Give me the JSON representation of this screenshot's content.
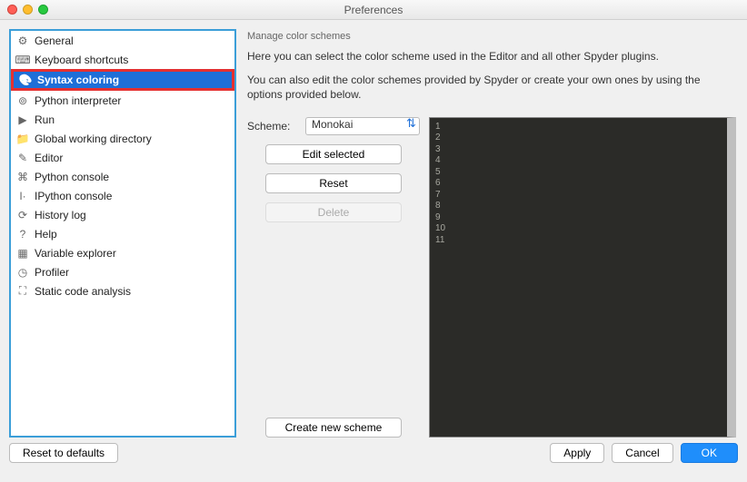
{
  "window": {
    "title": "Preferences"
  },
  "sidebar": {
    "items": [
      {
        "label": "General",
        "icon": "gear-icon",
        "selected": false
      },
      {
        "label": "Keyboard shortcuts",
        "icon": "keyboard-icon",
        "selected": false
      },
      {
        "label": "Syntax coloring",
        "icon": "palette-icon",
        "selected": true
      },
      {
        "label": "Python interpreter",
        "icon": "python-icon",
        "selected": false
      },
      {
        "label": "Run",
        "icon": "play-icon",
        "selected": false
      },
      {
        "label": "Global working directory",
        "icon": "folder-icon",
        "selected": false
      },
      {
        "label": "Editor",
        "icon": "pencil-icon",
        "selected": false
      },
      {
        "label": "Python console",
        "icon": "terminal-icon",
        "selected": false
      },
      {
        "label": "IPython console",
        "icon": "ipy-icon",
        "selected": false
      },
      {
        "label": "History log",
        "icon": "clock-icon",
        "selected": false
      },
      {
        "label": "Help",
        "icon": "help-icon",
        "selected": false
      },
      {
        "label": "Variable explorer",
        "icon": "table-icon",
        "selected": false
      },
      {
        "label": "Profiler",
        "icon": "profiler-icon",
        "selected": false
      },
      {
        "label": "Static code analysis",
        "icon": "bug-icon",
        "selected": false
      }
    ]
  },
  "section": {
    "title": "Manage color schemes",
    "desc1": "Here you can select the color scheme used in the Editor and all other Spyder plugins.",
    "desc2": "You can also edit the color schemes provided by Spyder or create your own ones by using the options provided below."
  },
  "scheme": {
    "label": "Scheme:",
    "selected": "Monokai"
  },
  "buttons": {
    "edit": "Edit selected",
    "reset": "Reset",
    "delete": "Delete",
    "create": "Create new scheme"
  },
  "preview": {
    "lines": [
      "1",
      "2",
      "3",
      "4",
      "5",
      "6",
      "7",
      "8",
      "9",
      "10",
      "11"
    ]
  },
  "footer": {
    "reset": "Reset to defaults",
    "apply": "Apply",
    "cancel": "Cancel",
    "ok": "OK"
  },
  "icons": {
    "gear-icon": "⚙",
    "keyboard-icon": "⌨",
    "palette-icon": "🎨",
    "python-icon": "⊚",
    "play-icon": "▶",
    "folder-icon": "📁",
    "pencil-icon": "✎",
    "terminal-icon": "⌘",
    "ipy-icon": "I·",
    "clock-icon": "⟳",
    "help-icon": "?",
    "table-icon": "▦",
    "profiler-icon": "◷",
    "bug-icon": "⛶"
  }
}
